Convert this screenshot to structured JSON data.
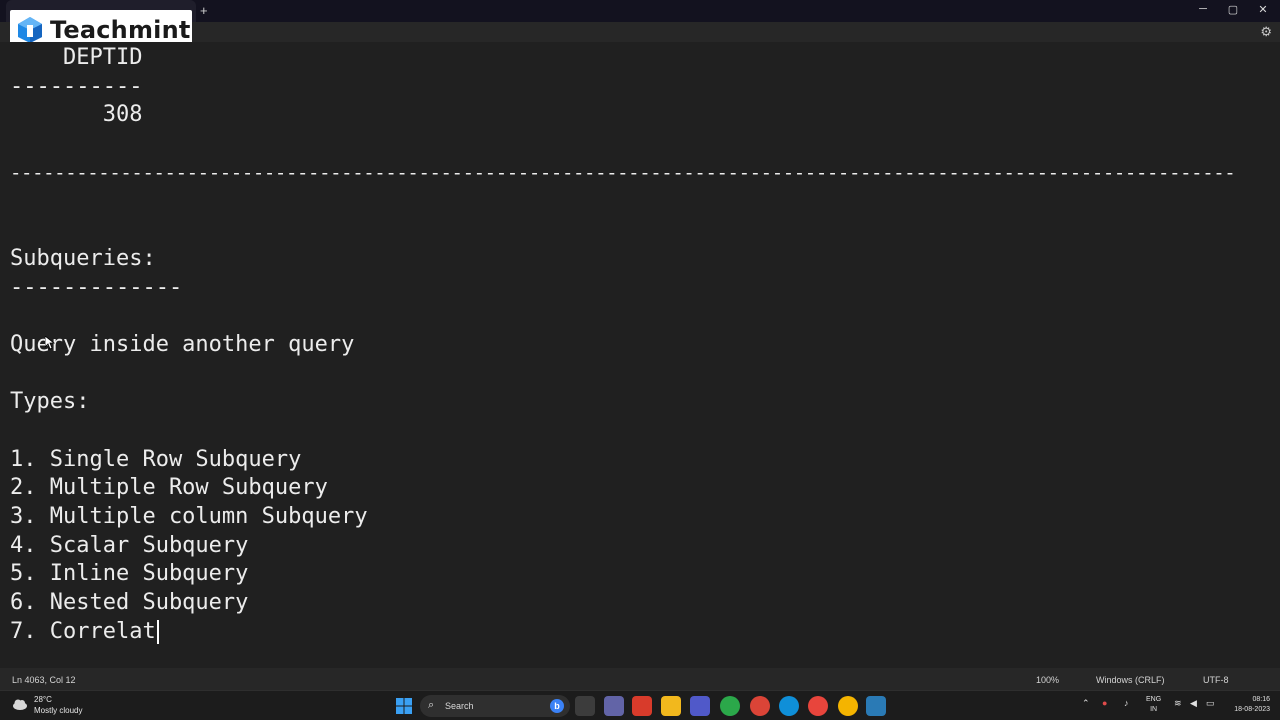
{
  "window": {
    "new_tab_icon": "+",
    "minimize_icon": "─",
    "restore_icon": "▢",
    "close_icon": "✕"
  },
  "logo": {
    "text": "Teachmint"
  },
  "editor": {
    "lines": [
      "    DEPTID",
      "----------",
      "       308",
      "",
      "---------------------------------------------------------------------------------------------------------------",
      "",
      "",
      "Subqueries:",
      "-------------",
      "",
      "Query inside another query",
      "",
      "Types:",
      "",
      "1. Single Row Subquery",
      "2. Multiple Row Subquery",
      "3. Multiple column Subquery",
      "4. Scalar Subquery",
      "5. Inline Subquery",
      "6. Nested Subquery",
      "7. Correlat"
    ]
  },
  "statusbar": {
    "position": "Ln 4063, Col 12",
    "zoom": "100%",
    "line_ending": "Windows (CRLF)",
    "encoding": "UTF-8"
  },
  "taskbar": {
    "weather_temp": "28°C",
    "weather_desc": "Mostly cloudy",
    "search_label": "Search",
    "lang_top": "ENG",
    "lang_bottom": "IN",
    "time": "08:16",
    "date": "18-08-2023"
  },
  "colors": {
    "editor_bg": "#202020",
    "text": "#ececec",
    "accent": "#0078d4"
  }
}
